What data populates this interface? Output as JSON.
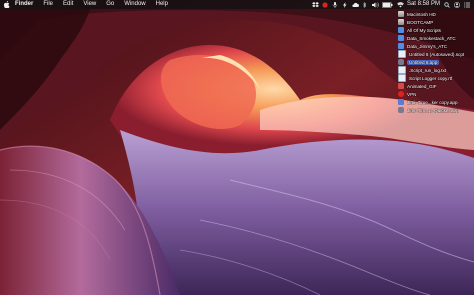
{
  "menubar": {
    "app_name": "Finder",
    "menus": [
      "File",
      "Edit",
      "View",
      "Go",
      "Window",
      "Help"
    ],
    "clock": "Sat 8:58 PM",
    "icons": [
      "apple-icon",
      "dropbox-icon",
      "record-icon",
      "mic-icon",
      "lightning-icon",
      "cloud-icon",
      "bluetooth-icon",
      "volume-icon",
      "battery-icon",
      "wifi-icon",
      "search-icon",
      "user-icon",
      "notification-center-icon"
    ],
    "battery_level": 1.0
  },
  "desktop": {
    "wallpaper": "antelope-canyon",
    "items": [
      {
        "label": "Macintosh HD",
        "icon": "drive-icon"
      },
      {
        "label": "BOOTCAMP",
        "icon": "drive-icon"
      },
      {
        "label": "All Of My Scripts",
        "icon": "folder-icon"
      },
      {
        "label": "Data_Smokestack_ATC",
        "icon": "folder-icon"
      },
      {
        "label": "Data_Jimmy's_ATC",
        "icon": "folder-icon"
      },
      {
        "label": "Untitled 6 (Autosaved).scpt",
        "icon": "script-icon"
      },
      {
        "label": "Untitled 6.app",
        "icon": "app-icon"
      },
      {
        "label": ".Script_run_log.txt",
        "icon": "document-icon"
      },
      {
        "label": "Script Logger copy.rtf",
        "icon": "document-icon"
      },
      {
        "label": "Animated_GIF",
        "icon": "gif-icon"
      },
      {
        "label": "VPN",
        "icon": "vpn-icon"
      },
      {
        "label": "Jimi_Time...ker copy.app",
        "icon": "app-icon"
      },
      {
        "label": "Jimi_Tim...p_Quicker.app",
        "icon": "app-icon"
      }
    ],
    "selected_index": 6
  }
}
